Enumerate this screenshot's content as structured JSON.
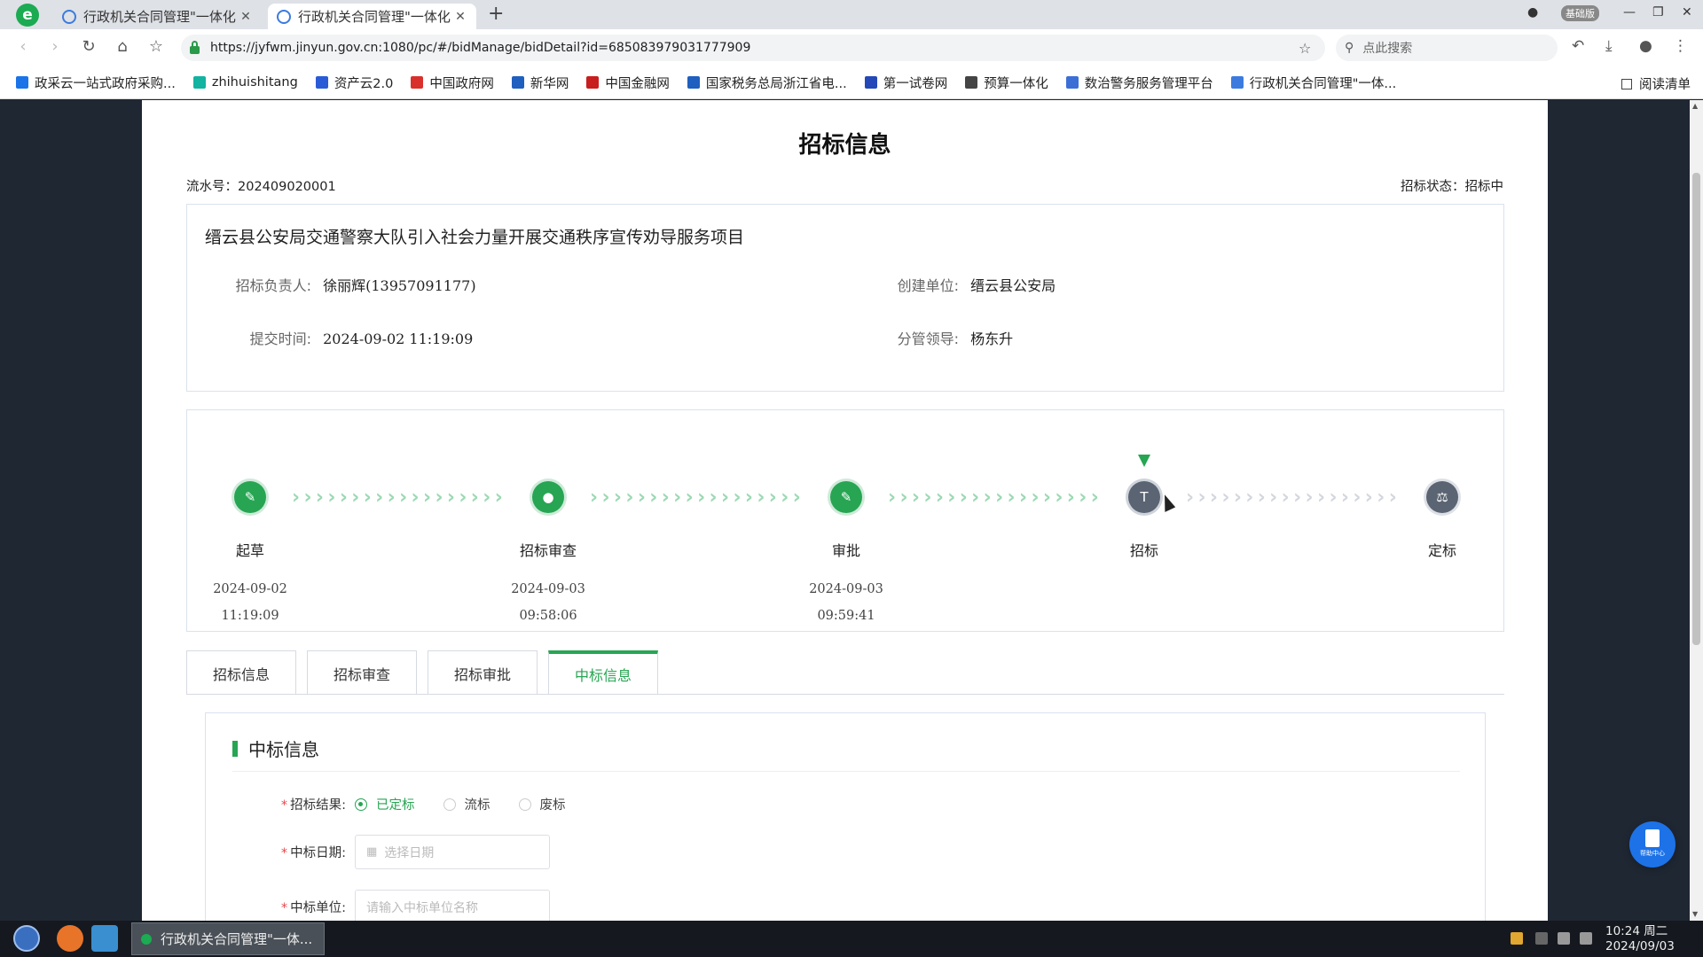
{
  "browser": {
    "logo": "e",
    "tabs": [
      {
        "title": "行政机关合同管理\"一体化",
        "close": "✕"
      },
      {
        "title": "行政机关合同管理\"一体化",
        "close": "✕"
      }
    ],
    "new_tab": "+",
    "vip_badge": "基础版",
    "url": "https://jyfwm.jinyun.gov.cn:1080/pc/#/bidManage/bidDetail?id=685083979031777909",
    "search_placeholder": "点此搜索",
    "bookmarks": [
      {
        "label": "政采云一站式政府采购...",
        "color": "#1a73e8"
      },
      {
        "label": "zhihuishitang",
        "color": "#12b3a0"
      },
      {
        "label": "资产云2.0",
        "color": "#2a5bd7"
      },
      {
        "label": "中国政府网",
        "color": "#d9302c"
      },
      {
        "label": "新华网",
        "color": "#1f5fbf"
      },
      {
        "label": "中国金融网",
        "color": "#c81e1e"
      },
      {
        "label": "国家税务总局浙江省电...",
        "color": "#1f5fbf"
      },
      {
        "label": "第一试卷网",
        "color": "#2448b8"
      },
      {
        "label": "预算一体化",
        "color": "#444444"
      },
      {
        "label": "数治警务服务管理平台",
        "color": "#3b6fd6"
      },
      {
        "label": "行政机关合同管理\"一体...",
        "color": "#3b7be0"
      }
    ],
    "reading_list": "阅读清单"
  },
  "page": {
    "title": "招标信息",
    "serial_label": "流水号：",
    "serial_value": "202409020001",
    "status_label": "招标状态：",
    "status_value": "招标中",
    "project_title": "缙云县公安局交通警察大队引入社会力量开展交通秩序宣传劝导服务项目",
    "fields": {
      "owner_label": "招标负责人:",
      "owner_value": "徐丽辉(13957091177)",
      "unit_label": "创建单位:",
      "unit_value": "缙云县公安局",
      "submit_label": "提交时间:",
      "submit_value": "2024-09-02 11:19:09",
      "leader_label": "分管领导:",
      "leader_value": "杨东升"
    },
    "steps": [
      {
        "label": "起草",
        "date": "2024-09-02",
        "time": "11:19:09",
        "state": "done",
        "icon": "pin-icon"
      },
      {
        "label": "招标审查",
        "date": "2024-09-03",
        "time": "09:58:06",
        "state": "done",
        "icon": "user-icon"
      },
      {
        "label": "审批",
        "date": "2024-09-03",
        "time": "09:59:41",
        "state": "done",
        "icon": "edit-icon"
      },
      {
        "label": "招标",
        "date": "",
        "time": "",
        "state": "current",
        "icon": "hammer-icon"
      },
      {
        "label": "定标",
        "date": "",
        "time": "",
        "state": "pending",
        "icon": "gavel-icon"
      }
    ],
    "tabs": [
      {
        "label": "招标信息",
        "active": false
      },
      {
        "label": "招标审查",
        "active": false
      },
      {
        "label": "招标审批",
        "active": false
      },
      {
        "label": "中标信息",
        "active": true
      }
    ],
    "section": {
      "title": "中标信息",
      "result_label": "招标结果:",
      "result_options": [
        "已定标",
        "流标",
        "废标"
      ],
      "result_selected": "已定标",
      "date_label": "中标日期:",
      "date_placeholder": "选择日期",
      "unit_label": "中标单位:",
      "unit_placeholder": "请输入中标单位名称"
    },
    "help_label": "帮助中心"
  },
  "taskbar": {
    "task_title": "行政机关合同管理\"一体...",
    "time": "10:24 周二",
    "date": "2024/09/03"
  },
  "colors": {
    "accent": "#27a553",
    "required": "#e5484d"
  }
}
